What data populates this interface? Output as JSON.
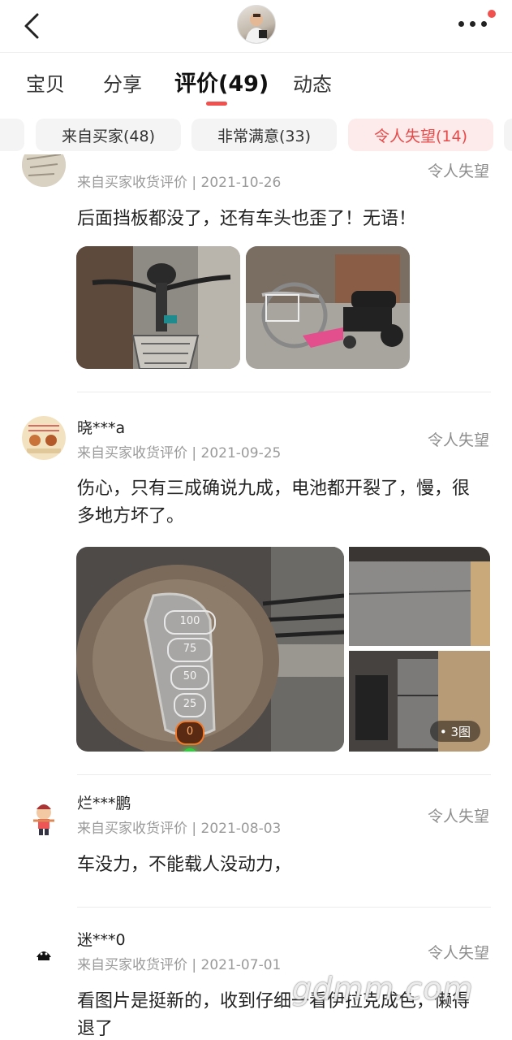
{
  "header": {
    "back_icon": "chevron-left-icon",
    "more_icon": "more-horizontal-icon"
  },
  "tabs": [
    {
      "label": "宝贝"
    },
    {
      "label": "分享"
    },
    {
      "label": "评价(49)"
    },
    {
      "label": "动态"
    }
  ],
  "filters": [
    {
      "label": "来自买家(48)"
    },
    {
      "label": "非常满意(33)"
    },
    {
      "label": "令人失望(14)"
    }
  ],
  "reviews": [
    {
      "name": "",
      "meta": "来自买家收货评价 | 2021-10-26",
      "rating": "令人失望",
      "text": "后面挡板都没了，还有车头也歪了！无语！"
    },
    {
      "name": "晓***a",
      "meta": "来自买家收货评价 | 2021-09-25",
      "rating": "令人失望",
      "text": "伤心，只有三成确说九成，电池都开裂了，慢，很多地方坏了。",
      "photo_badge": "• 3图",
      "gauge": [
        "100",
        "75",
        "50",
        "25",
        "0"
      ]
    },
    {
      "name": "烂***鹏",
      "meta": "来自买家收货评价 | 2021-08-03",
      "rating": "令人失望",
      "text": "车没力，不能载人没动力，"
    },
    {
      "name": "迷***0",
      "meta": "来自买家收货评价 | 2021-07-01",
      "rating": "令人失望",
      "text": "看图片是挺新的，收到仔细一看伊拉克成色，懒得退了"
    }
  ],
  "watermark": "gdmm.com"
}
